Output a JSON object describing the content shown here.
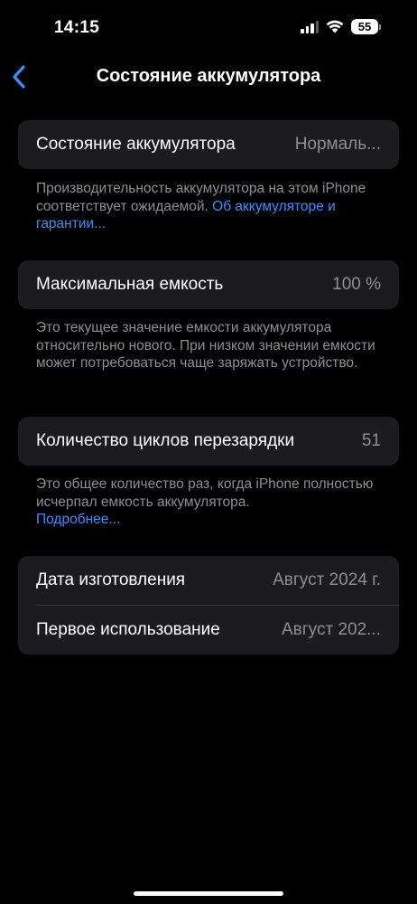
{
  "status_bar": {
    "time": "14:15",
    "battery_level": "55",
    "signal_icon": "cellular-signal-icon",
    "wifi_icon": "wifi-icon",
    "battery_icon": "battery-icon"
  },
  "nav": {
    "back_icon": "chevron-left-icon",
    "title": "Состояние аккумулятора"
  },
  "battery_health": {
    "label": "Состояние аккумулятора",
    "value": "Нормаль...",
    "footnote_text": "Производительность аккумулятора на этом iPhone соответствует ожидаемой.",
    "footnote_link": "Об аккуму­ляторе и гарантии..."
  },
  "max_capacity": {
    "label": "Максимальная емкость",
    "value": "100 %",
    "footnote_text": "Это текущее значение емкости аккумулятора относительно нового. При низком значении емкости может потребоваться чаще заряжать устройство."
  },
  "cycle_count": {
    "label": "Количество циклов перезарядки",
    "value": "51",
    "footnote_text": "Это общее количество раз, когда iPhone полностью исчерпал емкость аккумулятора.",
    "footnote_link": "Подробнее..."
  },
  "dates": {
    "manufacture_label": "Дата изготовления",
    "manufacture_value": "Август 2024 г.",
    "first_use_label": "Первое использование",
    "first_use_value": "Август 202..."
  },
  "colors": {
    "background": "#000000",
    "group_background": "#1c1c1e",
    "secondary_text": "#8e8e93",
    "link": "#3a8fff",
    "back_chevron": "#3a8fff"
  }
}
